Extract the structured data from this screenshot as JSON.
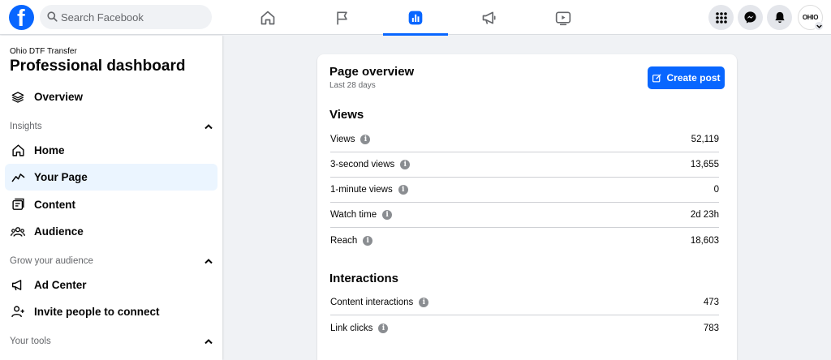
{
  "topbar": {
    "logo_letter": "f",
    "search_placeholder": "Search Facebook",
    "avatar_text": "OHIO"
  },
  "sidebar": {
    "page_name": "Ohio DTF Transfer",
    "title": "Professional dashboard",
    "overview_label": "Overview",
    "sections": {
      "insights": "Insights",
      "grow": "Grow your audience",
      "tools": "Your tools"
    },
    "items": {
      "home": "Home",
      "your_page": "Your Page",
      "content": "Content",
      "audience": "Audience",
      "ad_center": "Ad Center",
      "invite": "Invite people to connect"
    }
  },
  "main": {
    "title": "Page overview",
    "subtitle": "Last 28 days",
    "create_post_label": "Create post",
    "views_title": "Views",
    "views": [
      {
        "label": "Views",
        "value": "52,119"
      },
      {
        "label": "3-second views",
        "value": "13,655"
      },
      {
        "label": "1-minute views",
        "value": "0"
      },
      {
        "label": "Watch time",
        "value": "2d 23h"
      },
      {
        "label": "Reach",
        "value": "18,603"
      }
    ],
    "interactions_title": "Interactions",
    "interactions": [
      {
        "label": "Content interactions",
        "value": "473"
      },
      {
        "label": "Link clicks",
        "value": "783"
      }
    ]
  },
  "colors": {
    "accent": "#0866ff",
    "active_bg": "#ebf5ff",
    "page_bg": "#f0f2f5"
  }
}
